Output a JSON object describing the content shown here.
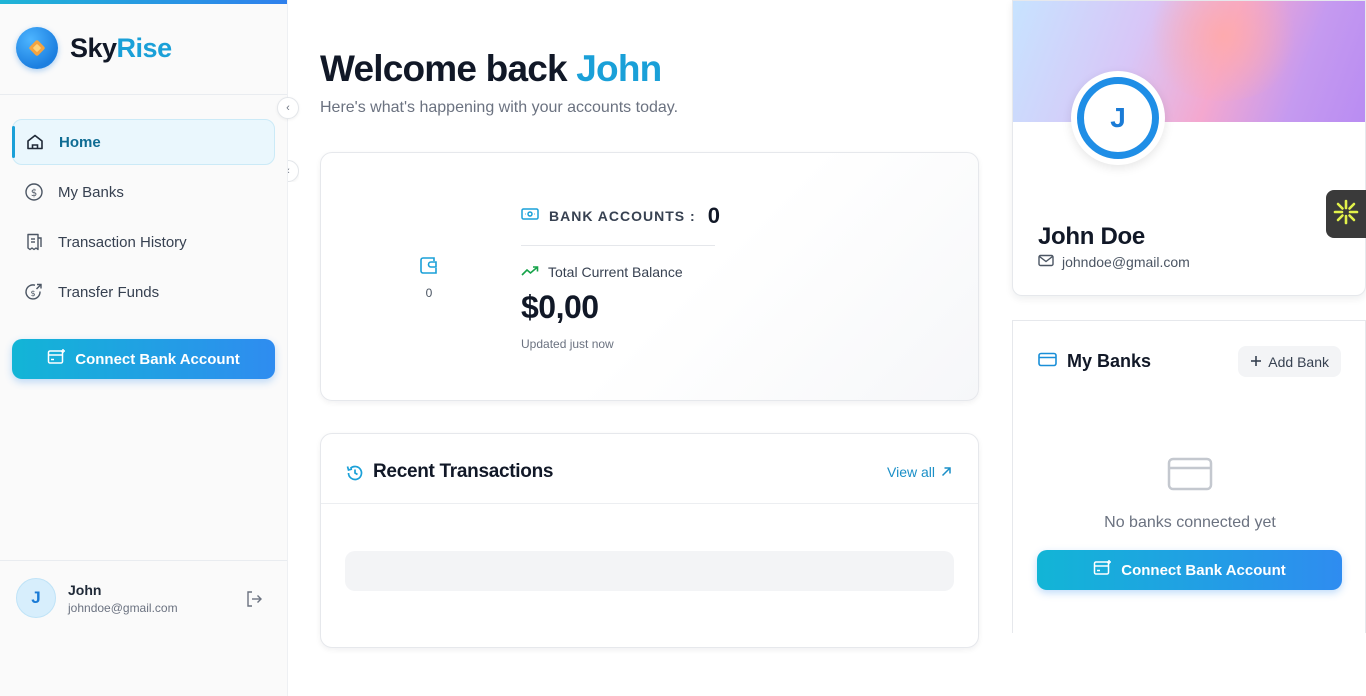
{
  "brand": {
    "name_part1": "Sky",
    "name_part2": "Rise"
  },
  "sidebar": {
    "items": [
      {
        "label": "Home",
        "icon": "home-icon",
        "active": true
      },
      {
        "label": "My Banks",
        "icon": "dollar-circle-icon",
        "active": false
      },
      {
        "label": "Transaction History",
        "icon": "receipt-icon",
        "active": false
      },
      {
        "label": "Transfer Funds",
        "icon": "transfer-icon",
        "active": false
      }
    ],
    "connect_label": "Connect Bank Account",
    "user": {
      "initial": "J",
      "name": "John",
      "email": "johndoe@gmail.com"
    }
  },
  "main": {
    "welcome_prefix": "Welcome back",
    "welcome_name": "John",
    "subtitle": "Here's what's happening with your accounts today.",
    "balance": {
      "wallet_count": "0",
      "accounts_label": "BANK ACCOUNTS :",
      "accounts_value": "0",
      "total_label": "Total Current Balance",
      "amount": "$0,00",
      "updated": "Updated just now"
    },
    "transactions": {
      "title": "Recent Transactions",
      "view_all": "View all"
    }
  },
  "profile": {
    "initial": "J",
    "name": "John Doe",
    "email": "johndoe@gmail.com"
  },
  "banks": {
    "title": "My Banks",
    "add_label": "Add Bank",
    "empty_text": "No banks connected yet",
    "connect_label": "Connect Bank Account"
  },
  "colors": {
    "accent": "#1aa0d8",
    "gradient_start": "#12b5d6",
    "gradient_end": "#2f8cf0",
    "text_primary": "#111827",
    "text_muted": "#6b7280"
  }
}
